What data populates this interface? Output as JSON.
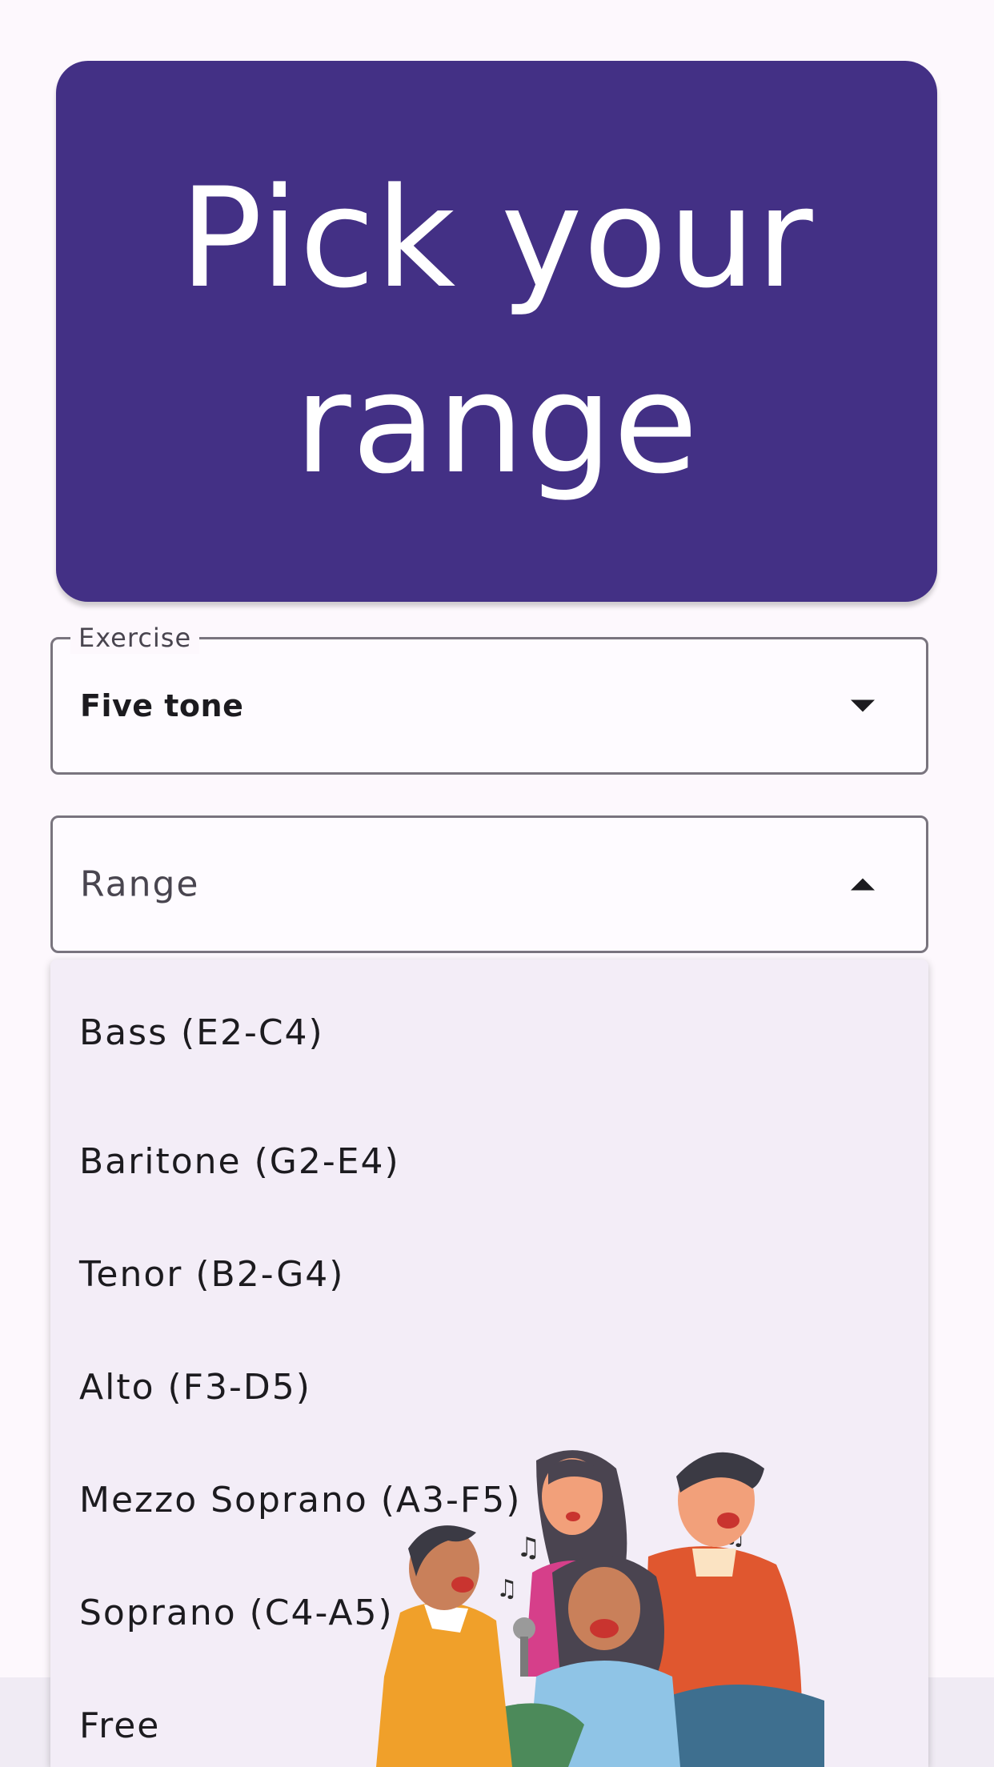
{
  "header": {
    "title": "Pick your range"
  },
  "exercise_field": {
    "label": "Exercise",
    "value": "Five tone"
  },
  "range_field": {
    "placeholder": "Range"
  },
  "range_menu": {
    "options": [
      "Bass (E2-C4)",
      "Baritone (G2-E4)",
      "Tenor (B2-G4)",
      "Alto (F3-D5)",
      "Mezzo Soprano (A3-F5)",
      "Soprano (C4-A5)",
      "Free"
    ]
  },
  "colors": {
    "header_bg": "#433085",
    "page_bg": "#fdf8fd",
    "menu_bg": "#f3edf7",
    "outline": "#79747e"
  },
  "icons": {
    "dropdown_closed": "arrow-drop-down-icon",
    "dropdown_open": "arrow-drop-up-icon"
  }
}
